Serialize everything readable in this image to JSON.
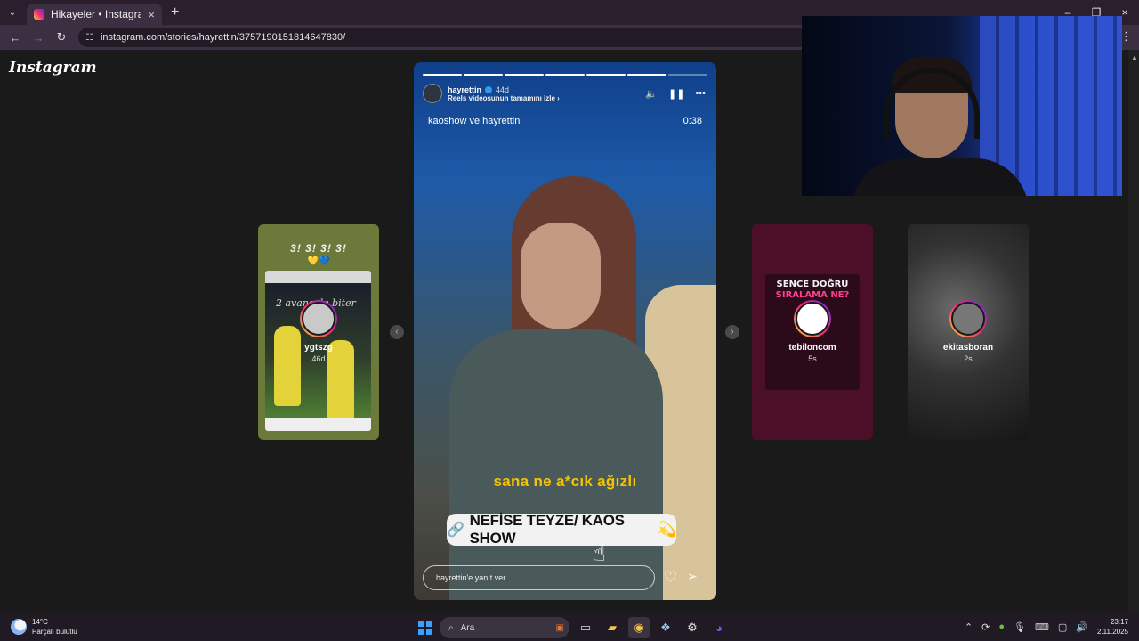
{
  "browser": {
    "tab_title": "Hikayeler • Instagram",
    "tab_close": "×",
    "new_tab": "+",
    "url": "instagram.com/stories/hayrettin/3757190151814647830/",
    "window_controls": [
      "–",
      "❐",
      "×"
    ]
  },
  "page": {
    "logo": "Instagram"
  },
  "story": {
    "username": "hayrettin",
    "age": "44d",
    "reels_link": "Reels videosunun tamamını izle ›",
    "overlay_title": "kaoshow ve hayrettin",
    "overlay_time": "0:38",
    "subtitle": "sana ne a*cık ağızlı",
    "link_sticker": "NEFİSE TEYZE/ KAOS SHOW",
    "reply_placeholder": "hayrettin'e yanıt ver...",
    "progress_total": 7,
    "progress_done": 6
  },
  "side_stories": [
    {
      "name": "ygtszg",
      "time": "46d",
      "header": "3! 3! 3! 3!",
      "hearts": "💛💙",
      "post_text": "2 avans ile biter"
    },
    {
      "name": "tebiloncom",
      "time": "5s",
      "title_line1": "SENCE DOĞRU",
      "title_line2": "SIRALAMA NE?"
    },
    {
      "name": "ekitasboran",
      "time": "2s"
    }
  ],
  "taskbar": {
    "temp": "14°C",
    "weather": "Parçalı bulutlu",
    "search": "Ara",
    "time": "23:17",
    "date": "2.11.2025"
  }
}
